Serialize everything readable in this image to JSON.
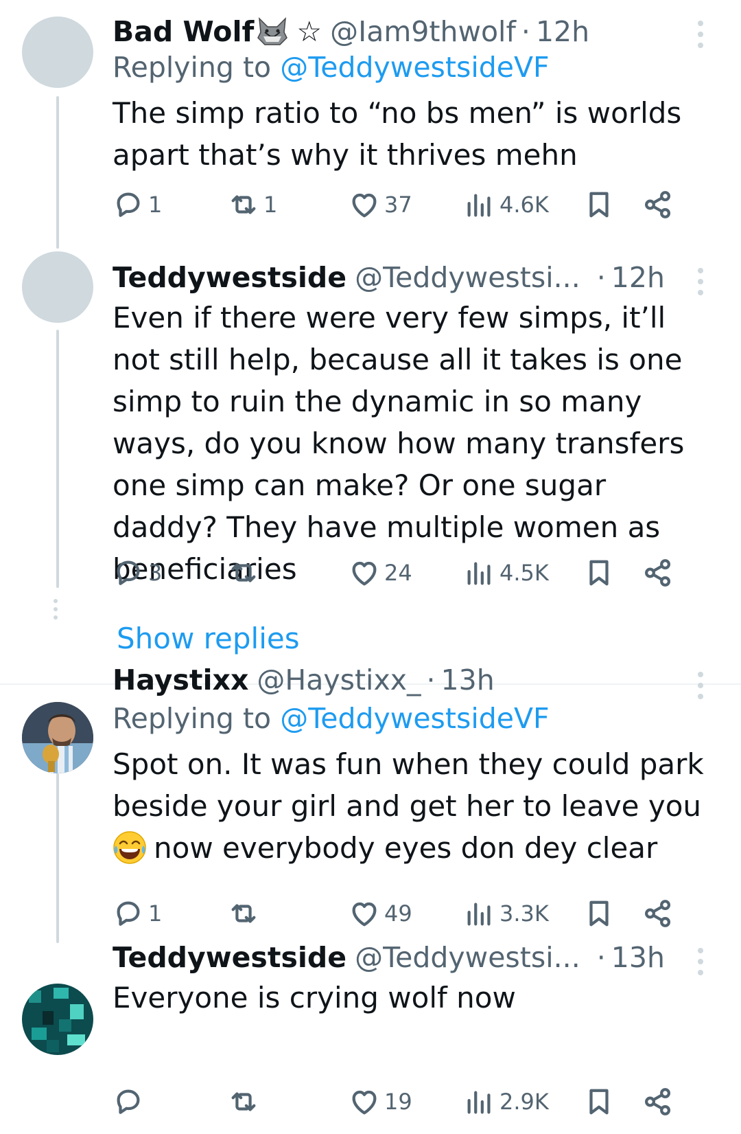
{
  "tweets": [
    {
      "name": "Bad Wolf",
      "name_suffix": "☆",
      "handle": "@Iam9thwolf",
      "sep": "·",
      "time": "12h",
      "replying_prefix": "Replying to ",
      "replying_to": "@TeddywestsideVF",
      "text": "The simp ratio to “no bs men” is worlds apart that’s why it thrives mehn",
      "replies": "1",
      "retweets": "1",
      "likes": "37",
      "views": "4.6K"
    },
    {
      "name": "Teddywestside",
      "handle": "@Teddywestsi...",
      "sep": "·",
      "time": "12h",
      "text": "Even if there were very few simps, it’ll not still help, because all it takes is one simp to ruin the dynamic in so many ways, do you know how many transfers one simp can make? Or one sugar daddy? They have multiple women as beneficiaries",
      "replies": "3",
      "retweets": "",
      "likes": "24",
      "views": "4.5K"
    },
    {
      "name": "Haystixx",
      "handle": "@Haystixx_",
      "sep": "·",
      "time": "13h",
      "replying_prefix": "Replying to ",
      "replying_to": "@TeddywestsideVF",
      "text_line1": "Spot on. It was fun when they could park beside your girl and get her to leave you",
      "text_line2": "now everybody eyes don dey clear",
      "replies": "1",
      "retweets": "",
      "likes": "49",
      "views": "3.3K"
    },
    {
      "name": "Teddywestside",
      "handle": "@Teddywestsi...",
      "sep": "·",
      "time": "13h",
      "text": "Everyone is crying wolf now",
      "replies": "",
      "retweets": "",
      "likes": "19",
      "views": "2.9K"
    }
  ],
  "show_replies": "Show replies",
  "icons": [
    "reply-icon",
    "retweet-icon",
    "like-icon",
    "views-icon",
    "bookmark-icon",
    "share-icon",
    "more-options-icon",
    "wolf-emoji",
    "laughing-emoji"
  ]
}
